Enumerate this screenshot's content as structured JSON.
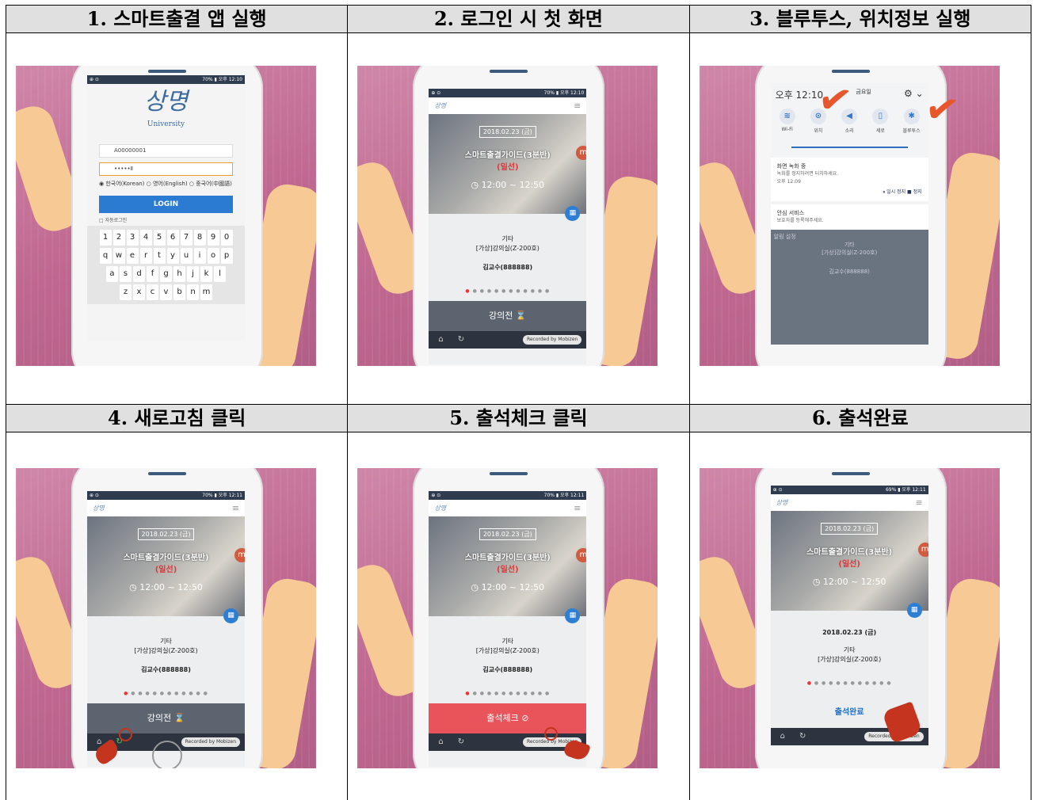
{
  "panels": [
    {
      "heading": "1. 스마트출결 앱 실행"
    },
    {
      "heading": "2. 로그인 시 첫 화면"
    },
    {
      "heading": "3. 블루투스, 위치정보 실행"
    },
    {
      "heading": "4. 새로고침 클릭"
    },
    {
      "heading": "5. 출석체크 클릭"
    },
    {
      "heading": "6. 출석완료"
    }
  ],
  "status_bar": {
    "left": "⊕ ⊙",
    "right_a": "70% ▮ 오후 12:10",
    "right_b": "70% ▮ 오후 12:11",
    "right_c": "69% ▮ 오후 12:11"
  },
  "login": {
    "logo_text": "상명",
    "logo_sub": "University",
    "id_value": "A00000001",
    "pw_value": "•••••Ⅱ",
    "languages": "◉ 한국어(Korean) ○ 영어(English) ○ 중국어(中國語)",
    "login_button": "LOGIN",
    "auto_login": "□ 자동로그인",
    "keyboard_rows": [
      "1234567890",
      "qwertyuiop",
      "asdfghjkl",
      "zxcvbnm"
    ]
  },
  "app": {
    "brand": "상명",
    "menu": "≡",
    "date": "2018.02.23 (금)",
    "course": "스마트출결가이드(3분반)",
    "type": "(일선)",
    "time": "◷ 12:00 ~ 12:50",
    "category": "기타",
    "room": "[가상]강의실(Z-200호)",
    "professor": "김교수(888888)",
    "before": "강의전 ⌛",
    "check": "출석체크 ⊘",
    "done": "출석완료",
    "recorded": "Recorded by Mobizen"
  },
  "notifications": {
    "clock": "오후 12:10",
    "day": "금요일",
    "toggles": [
      {
        "label": "Wi-Fi",
        "icon": "wifi-icon",
        "glyph": "≋"
      },
      {
        "label": "위치",
        "icon": "location-icon",
        "glyph": "⊙"
      },
      {
        "label": "소리",
        "icon": "sound-icon",
        "glyph": "◀"
      },
      {
        "label": "세로",
        "icon": "rotation-icon",
        "glyph": "▯"
      },
      {
        "label": "블루투스",
        "icon": "bluetooth-icon",
        "glyph": "✱"
      }
    ],
    "rec_title": "화면 녹화 중",
    "rec_sub": "녹화를 정지하려면 터치하세요.",
    "rec_time": "오후 12:09",
    "pause": "⏸ 일시 정지",
    "stop": "■ 정지",
    "safe_title": "안심 서비스",
    "safe_sub": "보호자를 등록해주세요.",
    "alarm": "알림 설정"
  }
}
